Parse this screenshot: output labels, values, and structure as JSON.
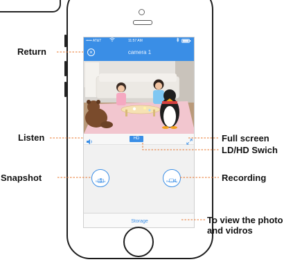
{
  "app": {
    "status": {
      "carrier": "••••• AT&T",
      "time": "11:57 AM"
    },
    "nav_title": "camera 1",
    "close_glyph": "×",
    "hd_label": "HD",
    "snapshot_label": "Snapshot",
    "recording_label": "Recording",
    "storage_label": "Storage"
  },
  "callouts": {
    "return": "Return",
    "listen": "Listen",
    "snapshot": "Snapshot",
    "full_screen": "Full screen",
    "ld_hd_switch": "LD/HD Swich",
    "recording": "Recording",
    "view_photo_line1": "To view the photo",
    "view_photo_line2": "and vidros"
  },
  "icons": {
    "wifi": "wifi-icon",
    "bluetooth": "bluetooth-icon",
    "battery": "battery-icon",
    "speaker": "speaker-icon",
    "fullscreen": "fullscreen-icon",
    "camera": "camera-icon",
    "video": "video-camera-icon"
  },
  "colors": {
    "accent": "#3a8ee6",
    "leader": "#e8742b",
    "video_wall": "#d9d6d2",
    "carpet": "#f2c6cf"
  }
}
